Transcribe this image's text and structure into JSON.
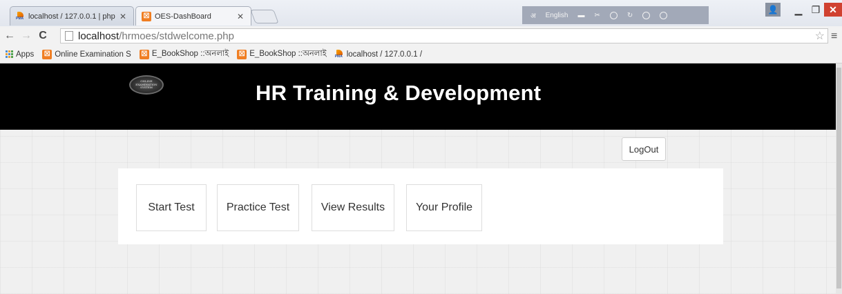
{
  "browser": {
    "tabs": [
      {
        "title": "localhost / 127.0.0.1 | php",
        "active": false
      },
      {
        "title": "OES-DashBoard",
        "active": true
      }
    ],
    "extension_label": "English",
    "url": {
      "host": "localhost",
      "path": "/hrmoes/stdwelcome.php"
    },
    "bookmarks": [
      {
        "label": "Apps",
        "icon": "apps-grid-icon"
      },
      {
        "label": "Online Examination S",
        "icon": "oes-icon"
      },
      {
        "label": "E_BookShop ::অনলাই",
        "icon": "oes-icon"
      },
      {
        "label": "E_BookShop ::অনলাই",
        "icon": "oes-icon"
      },
      {
        "label": "localhost / 127.0.0.1 /",
        "icon": "phpmyadmin-icon"
      }
    ],
    "colors": {
      "close": "#d04130",
      "tab_active": "#f4f5f8"
    }
  },
  "page": {
    "logo_text": [
      "ONLINE",
      "EXAMINATION",
      "SYSTEM"
    ],
    "title": "HR Training & Development",
    "logout_label": "LogOut",
    "menu": [
      {
        "label": "Start Test"
      },
      {
        "label": "Practice Test"
      },
      {
        "label": "View Results"
      },
      {
        "label": "Your Profile"
      }
    ],
    "colors": {
      "header_bg": "#000000",
      "header_text": "#ffffff",
      "page_bg": "#f0f0f0"
    }
  }
}
